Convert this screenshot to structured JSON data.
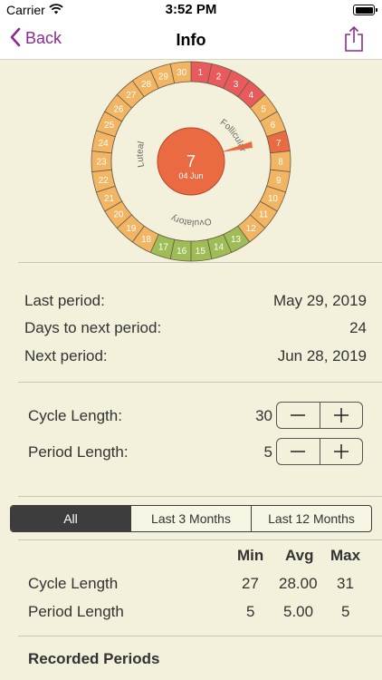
{
  "status_bar": {
    "carrier": "Carrier",
    "time": "3:52 PM"
  },
  "nav": {
    "back_label": "Back",
    "title": "Info"
  },
  "colors": {
    "period": "#e95a5c",
    "fertile": "#9ebd56",
    "normal": "#f1b563",
    "today": "#ea6b42",
    "accent": "#8a2c91"
  },
  "cycle_wheel": {
    "days": [
      "1",
      "2",
      "3",
      "4",
      "5",
      "6",
      "7",
      "8",
      "9",
      "10",
      "11",
      "12",
      "13",
      "14",
      "15",
      "16",
      "17",
      "18",
      "19",
      "20",
      "21",
      "22",
      "23",
      "24",
      "25",
      "26",
      "27",
      "28",
      "29",
      "30"
    ],
    "period_days": [
      1,
      2,
      3,
      4
    ],
    "fertile_days": [
      13,
      14,
      15,
      16,
      17
    ],
    "today_day": 7,
    "phase_labels": [
      "Follicular",
      "Ovulatory",
      "Luteal"
    ],
    "center_day": "7",
    "center_date": "04 Jun"
  },
  "info": {
    "last_period_label": "Last period:",
    "last_period_value": "May 29, 2019",
    "days_to_next_label": "Days to next period:",
    "days_to_next_value": "24",
    "next_period_label": "Next period:",
    "next_period_value": "Jun 28, 2019"
  },
  "settings": {
    "cycle_length_label": "Cycle Length:",
    "cycle_length_value": "30",
    "period_length_label": "Period Length:",
    "period_length_value": "5"
  },
  "filter": {
    "options": [
      "All",
      "Last 3 Months",
      "Last 12 Months"
    ],
    "selected": "All"
  },
  "stats": {
    "headers": [
      "Min",
      "Avg",
      "Max"
    ],
    "rows": [
      {
        "label": "Cycle Length",
        "min": "27",
        "avg": "28.00",
        "max": "31"
      },
      {
        "label": "Period Length",
        "min": "5",
        "avg": "5.00",
        "max": "5"
      }
    ]
  },
  "recorded_title": "Recorded Periods"
}
